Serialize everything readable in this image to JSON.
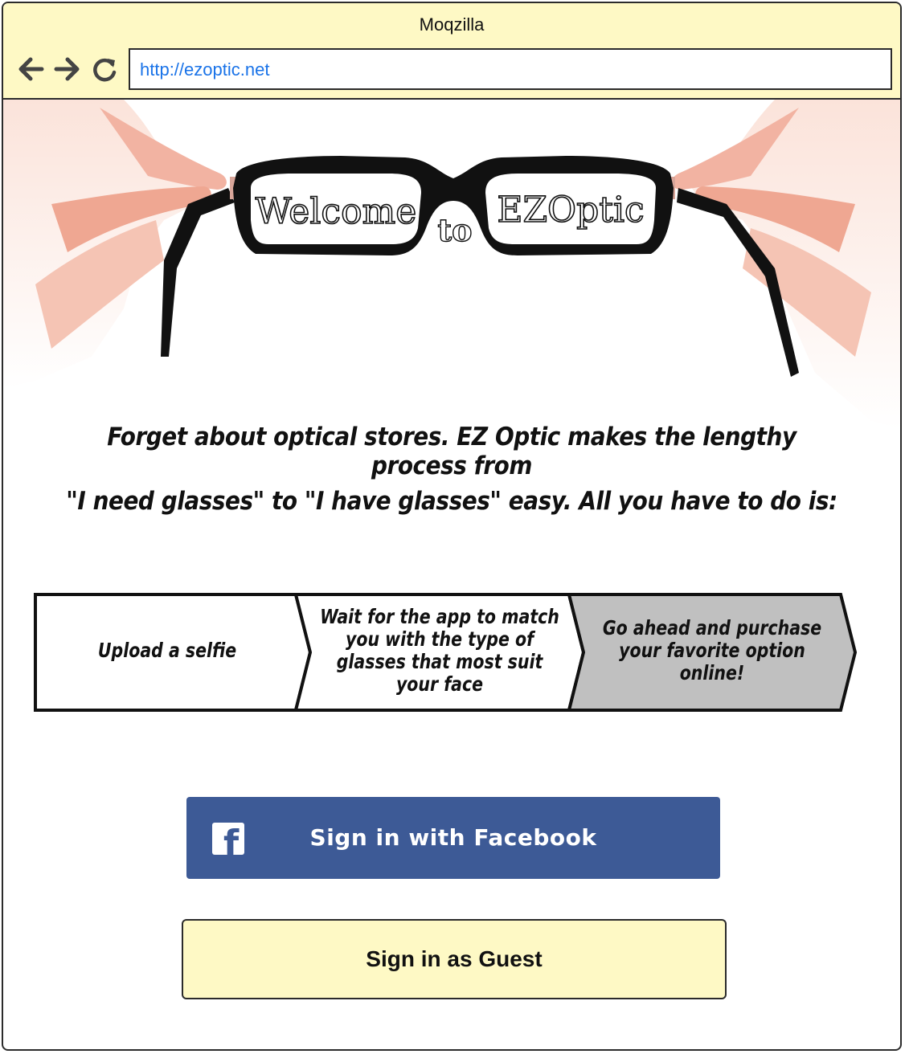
{
  "browser": {
    "title": "Moqzilla",
    "url": "http://ezoptic.net",
    "nav": {
      "back_icon": "arrow-left-icon",
      "forward_icon": "arrow-right-icon",
      "reload_icon": "reload-icon"
    }
  },
  "hero": {
    "welcome": "Welcome",
    "to": "to",
    "brand": "EZOptic"
  },
  "tagline": {
    "line1": "Forget about optical stores. EZ Optic makes the lengthy process from",
    "line2": "\"I need glasses\" to \"I have glasses\" easy. All you have to do is:"
  },
  "steps": [
    {
      "lines": [
        "Upload a selfie"
      ]
    },
    {
      "lines": [
        "Wait for the app to match",
        "you with the type of",
        "glasses that most suit",
        "your face"
      ]
    },
    {
      "lines": [
        "Go ahead and purchase",
        "your favorite option",
        "online!"
      ]
    }
  ],
  "buttons": {
    "facebook_label": "Sign in with Facebook",
    "facebook_icon": "facebook-icon",
    "guest_label": "Sign in as Guest"
  },
  "colors": {
    "chrome": "#fef9c5",
    "facebook": "#3d5a96",
    "url": "#1a73e8",
    "active_step": "#c0c0c0"
  }
}
